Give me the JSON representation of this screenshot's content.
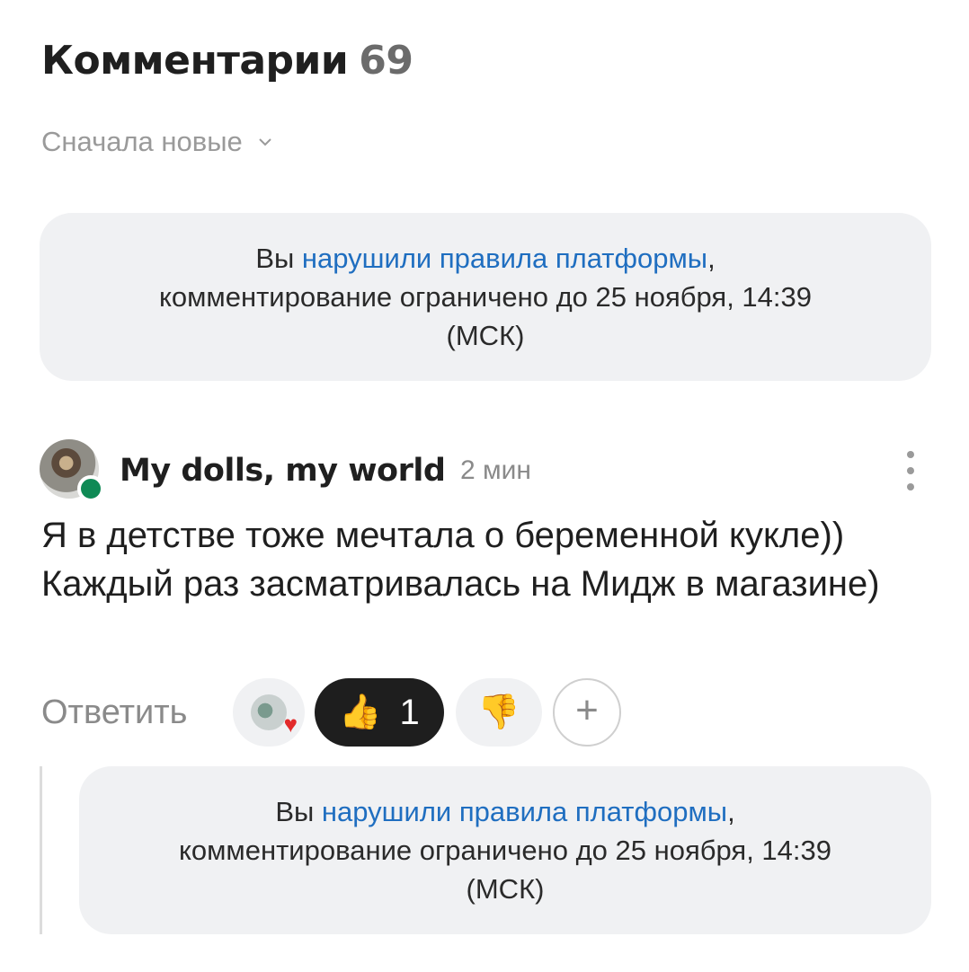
{
  "header": {
    "title": "Комментарии",
    "count": "69"
  },
  "sort": {
    "label": "Сначала новые",
    "icon": "chevron-down-icon"
  },
  "notice": {
    "prefix": "Вы ",
    "link": "нарушили правила платформы",
    "suffix": ",",
    "line2": "комментирование ограничено до 25 ноября, 14:39",
    "line3": "(МСК)"
  },
  "comment": {
    "author": "My dolls, my world",
    "time": "2 мин",
    "text": "Я в детстве тоже мечтала о беременной кукле)) Каждый раз засматривалась на Мидж в магазине)",
    "reply_label": "Ответить",
    "reactions": {
      "like_count": "1",
      "like_icon": "thumbs-up-icon",
      "dislike_icon": "thumbs-down-icon",
      "add_icon": "plus-icon"
    }
  },
  "reply_notice": {
    "prefix": "Вы ",
    "link": "нарушили правила платформы",
    "suffix": ",",
    "line2": "комментирование ограничено до 25 ноября, 14:39",
    "line3": "(МСК)"
  },
  "colors": {
    "link": "#1f6ec0",
    "online": "#0f8a55",
    "notice_bg": "#f0f1f3",
    "like_chip_bg": "#1e1e1e"
  }
}
